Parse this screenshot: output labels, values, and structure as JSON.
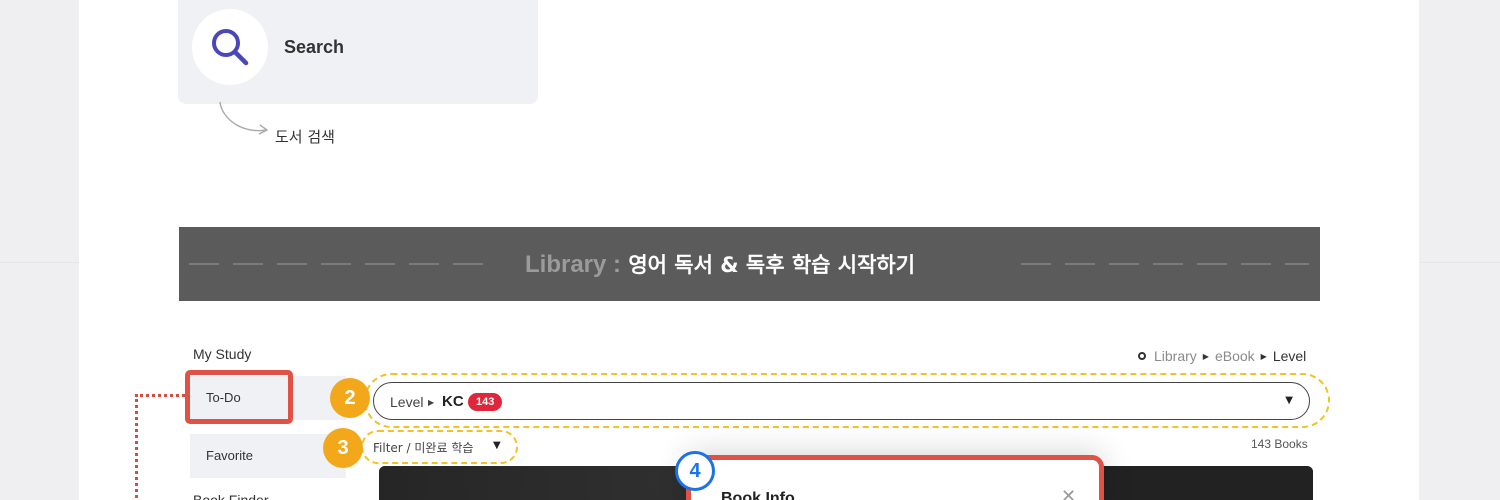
{
  "search": {
    "label": "Search",
    "caption": "도서 검색"
  },
  "banner": {
    "title_en": "Library :",
    "title_ko": " 영어 독서 & 독후 학습 시작하기"
  },
  "sidebar": {
    "section_title": "My Study",
    "items": [
      {
        "label": "To-Do"
      },
      {
        "label": "Favorite"
      },
      {
        "label": "Book Finder"
      }
    ]
  },
  "breadcrumb": [
    "Library",
    "eBook",
    "Level"
  ],
  "level_select": {
    "label": "Level",
    "value": "KC",
    "count": "143"
  },
  "filter": {
    "label": "Filter / 미완료 학습"
  },
  "books_count": "143 Books",
  "callouts": {
    "two": "2",
    "three": "3",
    "four": "4"
  },
  "modal": {
    "title": "Book Info"
  },
  "colors": {
    "highlight_red": "#e05245",
    "dash_yellow": "#f3c226",
    "badge_orange": "#f3a81b",
    "count_red": "#e0263a",
    "banner_gray": "#5b5b5b",
    "callout_blue": "#1a73e8"
  }
}
